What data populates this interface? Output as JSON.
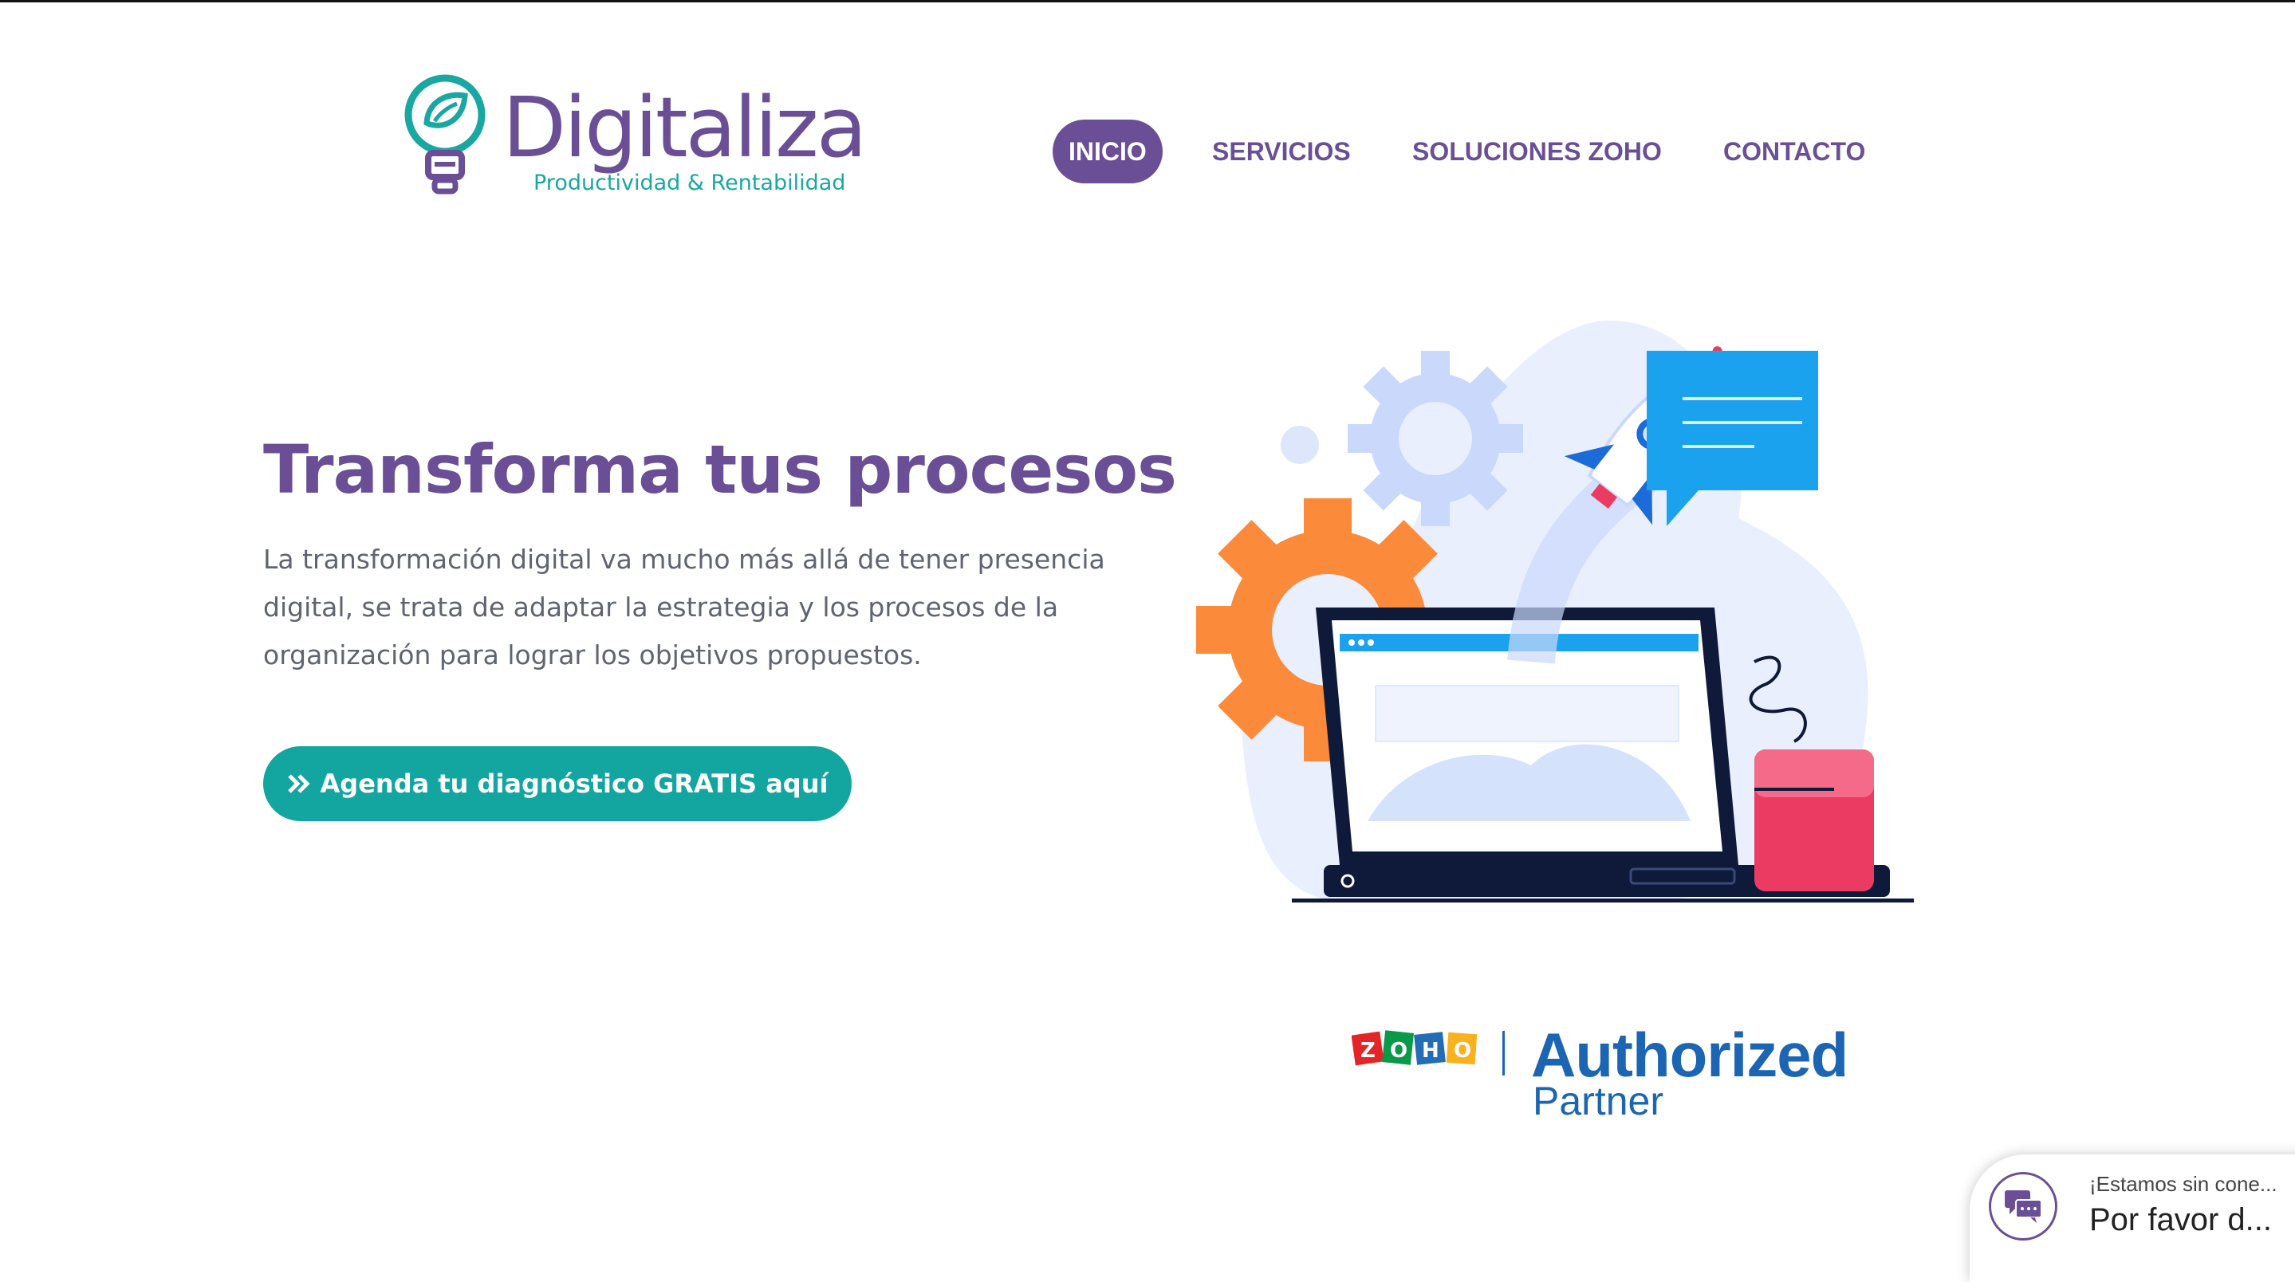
{
  "brand": {
    "name": "Digitaliza",
    "tagline": "Productividad & Rentabilidad",
    "primary_color": "#6a4f96",
    "accent_color": "#13a59f"
  },
  "nav": {
    "items": [
      {
        "label": "INICIO",
        "active": true
      },
      {
        "label": "SERVICIOS",
        "active": false
      },
      {
        "label": "SOLUCIONES ZOHO",
        "active": false
      },
      {
        "label": "CONTACTO",
        "active": false
      }
    ]
  },
  "hero": {
    "title": "Transforma tus procesos",
    "text_lines": [
      "La transformación digital va mucho más allá de tener presencia",
      "digital, se trata de adaptar la estrategia y los procesos de la",
      "organización para lograr los objetivos propuestos."
    ],
    "cta_label": "Agenda tu diagnóstico GRATIS aquí",
    "cta_icon": "double-chevron-right-icon",
    "illustration_icon": "laptop-rocket-gears-illustration"
  },
  "partner": {
    "brand": "ZOHO",
    "title": "Authorized",
    "subtitle": "Partner",
    "color": "#1b65b2"
  },
  "chat": {
    "status": "¡Estamos sin cone...",
    "message": "Por favor d...",
    "icon": "chat-bubbles-icon"
  }
}
